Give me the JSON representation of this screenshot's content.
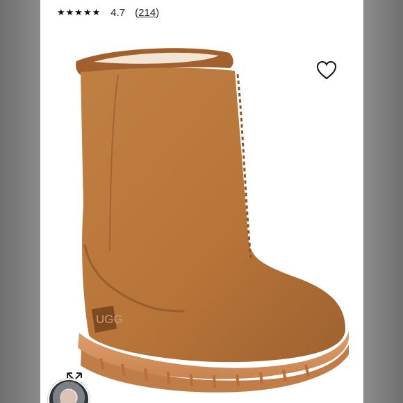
{
  "rating": {
    "stars": "★★★★★",
    "value": "4.7",
    "count_open": "(",
    "count": "214",
    "count_close": ")"
  },
  "icons": {
    "wishlist": "heart-icon",
    "expand": "expand-icon",
    "avatar": "user-avatar"
  },
  "product": {
    "logo_text": "UGG"
  },
  "colors": {
    "suede": "#b7783f",
    "suede_dark": "#8b5429",
    "sole": "#d79562",
    "background": "#ffffff"
  }
}
